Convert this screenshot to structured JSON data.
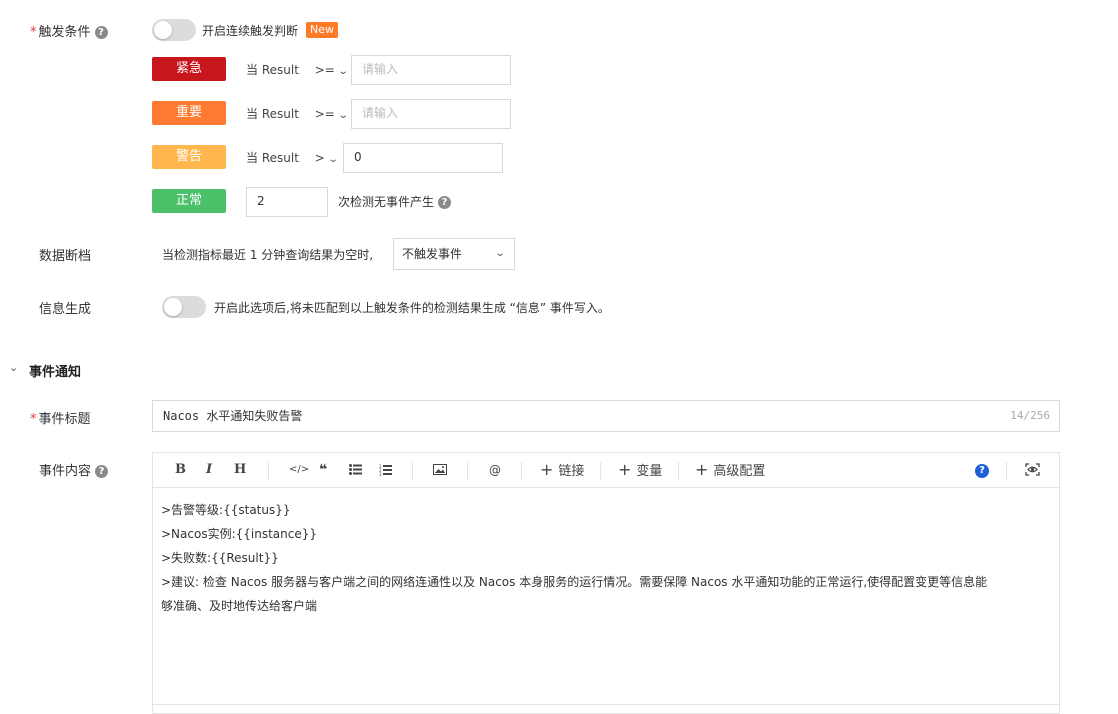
{
  "trigger": {
    "label": "触发条件",
    "continuous_toggle_label": "开启连续触发判断",
    "new_badge": "New",
    "levels": [
      {
        "name": "紧急",
        "color": "#c8161d",
        "when": "当 Result",
        "op": ">=",
        "value": "",
        "placeholder": "请输入"
      },
      {
        "name": "重要",
        "color": "#ff7a31",
        "when": "当 Result",
        "op": ">=",
        "value": "",
        "placeholder": "请输入"
      },
      {
        "name": "警告",
        "color": "#ffb74d",
        "when": "当 Result",
        "op": ">",
        "value": "0",
        "placeholder": ""
      },
      {
        "name": "正常",
        "color": "#4cc16a",
        "value": "2",
        "suffix": "次检测无事件产生"
      }
    ]
  },
  "data_gap": {
    "label": "数据断档",
    "desc": "当检测指标最近 1 分钟查询结果为空时,",
    "selected": "不触发事件"
  },
  "info_gen": {
    "label": "信息生成",
    "desc": "开启此选项后,将未匹配到以上触发条件的检测结果生成 “信息” 事件写入。"
  },
  "notify": {
    "section_title": "事件通知",
    "title_label": "事件标题",
    "title_value": "Nacos 水平通知失败告警",
    "title_count": "14/256",
    "content_label": "事件内容",
    "toolbar": {
      "bold": "B",
      "italic": "I",
      "heading": "H",
      "code": "</>",
      "quote": "❝",
      "link": "链接",
      "variable": "变量",
      "advanced": "高级配置",
      "at": "@",
      "help": "?"
    },
    "lines": [
      ">告警等级:{{status}}",
      ">Nacos实例:{{instance}}",
      ">失败数:{{Result}}",
      ">建议: 检查 Nacos 服务器与客户端之间的网络连通性以及 Nacos 本身服务的运行情况。需要保障 Nacos 水平通知功能的正常运行,使得配置变更等信息能",
      "够准确、及时地传达给客户端"
    ]
  },
  "colors": {
    "accent_help": "#1f5fd6",
    "required": "#e4393c"
  }
}
